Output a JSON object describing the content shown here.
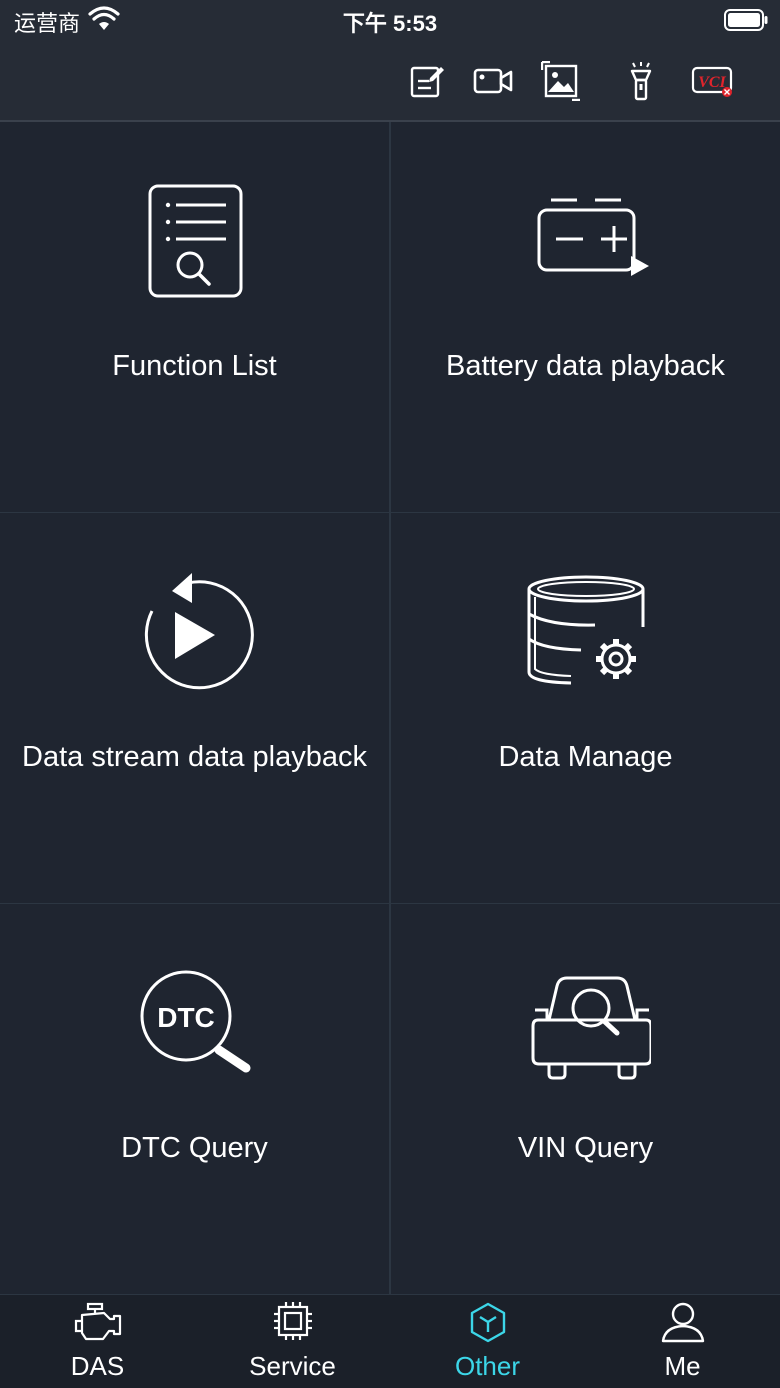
{
  "status_bar": {
    "carrier": "运营商",
    "time": "下午 5:53"
  },
  "toolbar": {
    "icons": [
      "edit-note-icon",
      "video-camera-icon",
      "image-icon",
      "flashlight-icon",
      "vci-icon"
    ],
    "vci_label": "VCI"
  },
  "tiles": [
    {
      "label": "Function List",
      "icon": "document-search-icon"
    },
    {
      "label": "Battery data playback",
      "icon": "battery-play-icon"
    },
    {
      "label": "Data stream data playback",
      "icon": "replay-icon"
    },
    {
      "label": "Data Manage",
      "icon": "database-gear-icon"
    },
    {
      "label": "DTC Query",
      "icon": "dtc-search-icon",
      "icon_text": "DTC"
    },
    {
      "label": "VIN Query",
      "icon": "car-search-icon"
    }
  ],
  "tabbar": {
    "items": [
      {
        "label": "DAS",
        "icon": "engine-icon",
        "active": false
      },
      {
        "label": "Service",
        "icon": "chip-icon",
        "active": false
      },
      {
        "label": "Other",
        "icon": "cube-icon",
        "active": true
      },
      {
        "label": "Me",
        "icon": "user-icon",
        "active": false
      }
    ]
  },
  "colors": {
    "background": "#1f2530",
    "header": "#262c36",
    "accent": "#3cd6e8",
    "vci_red": "#e0242c"
  }
}
